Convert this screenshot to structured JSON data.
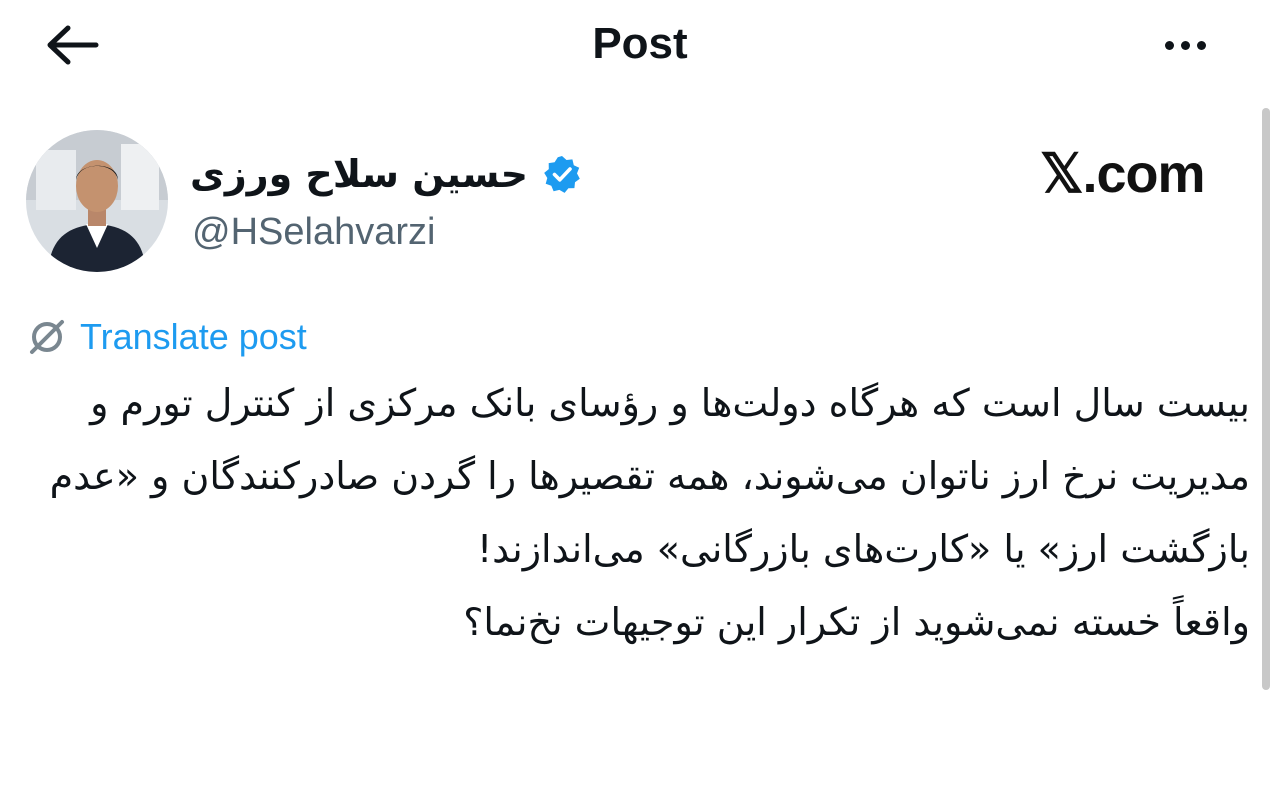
{
  "header": {
    "title": "Post"
  },
  "author": {
    "display_name": "حسین سلاح ورزی",
    "handle": "@HSelahvarzi",
    "verified": true
  },
  "watermark": "𝕏.com",
  "translate_label": "Translate post",
  "post": {
    "text": "بیست سال است که هرگاه دولت‌ها و رؤسای بانک مرکزی از کنترل تورم و مدیریت نرخ ارز ناتوان می‌شوند، همه تقصیرها را گردن صادرکنندگان و «عدم بازگشت ارز» یا «کارت‌های بازرگانی» می‌اندازند!\nواقعاً خسته نمی‌شوید از تکرار این توجیهات نخ‌نما؟"
  },
  "colors": {
    "accent": "#1d9bf0",
    "text": "#0f1419",
    "secondary": "#536471"
  },
  "icons": {
    "back": "arrow-left-icon",
    "more": "more-horizontal-icon",
    "verified": "verified-badge-icon",
    "translate": "translate-icon"
  }
}
